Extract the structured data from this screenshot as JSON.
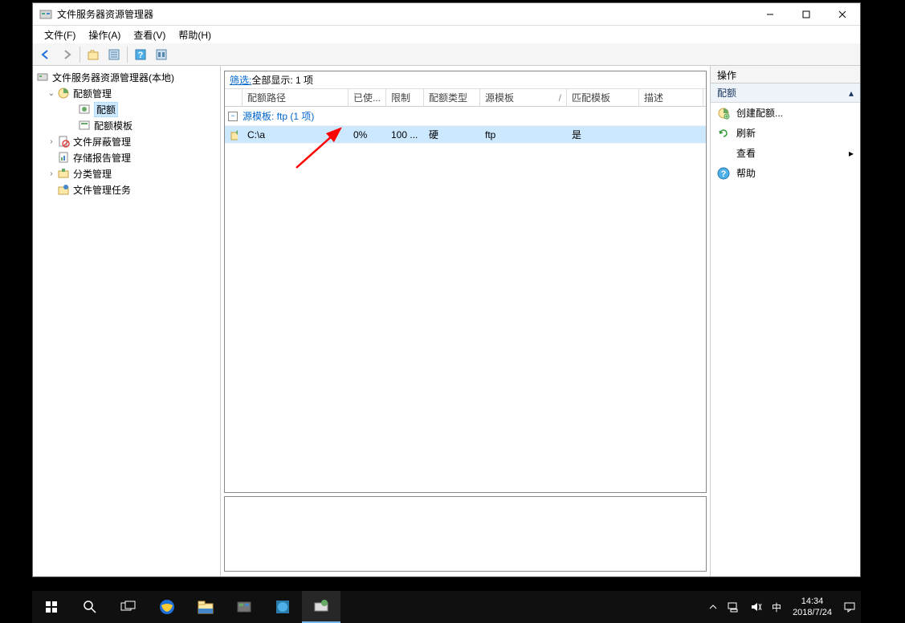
{
  "window": {
    "title": "文件服务器资源管理器"
  },
  "menu": {
    "file": "文件(F)",
    "action": "操作(A)",
    "view": "查看(V)",
    "help": "帮助(H)"
  },
  "tree": {
    "root": "文件服务器资源管理器(本地)",
    "quota_mgmt": "配额管理",
    "quota": "配额",
    "quota_template": "配额模板",
    "file_screen_mgmt": "文件屏蔽管理",
    "storage_reports": "存储报告管理",
    "classification_mgmt": "分类管理",
    "file_mgmt_tasks": "文件管理任务"
  },
  "filter": {
    "link_text": "筛选:",
    "text": "全部显示:  1 项"
  },
  "columns": {
    "path": "配额路径",
    "used": "已使...",
    "limit": "限制",
    "type": "配额类型",
    "source_template": "源模板",
    "match_template": "匹配模板",
    "description": "描述"
  },
  "group": {
    "label": "源模板: ftp (1 项)"
  },
  "row": {
    "path": "C:\\a",
    "used": "0%",
    "limit": "100 ...",
    "type": "硬",
    "source_template": "ftp",
    "match_template": "是",
    "description": ""
  },
  "actions": {
    "header": "操作",
    "section": "配额",
    "create_quota": "创建配额...",
    "refresh": "刷新",
    "view": "查看",
    "help": "帮助"
  },
  "taskbar": {
    "time": "14:34",
    "date": "2018/7/24",
    "ime": "中"
  }
}
